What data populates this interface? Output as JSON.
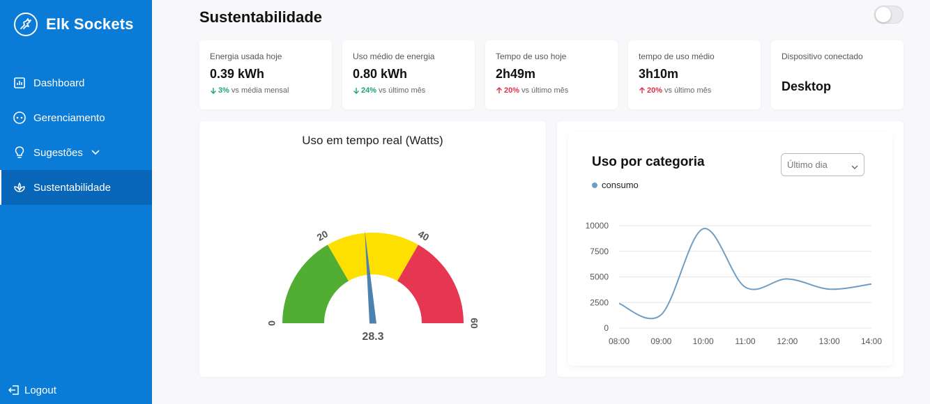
{
  "brand": {
    "name": "Elk Sockets"
  },
  "nav": {
    "items": [
      {
        "label": "Dashboard"
      },
      {
        "label": "Gerenciamento"
      },
      {
        "label": "Sugestões"
      },
      {
        "label": "Sustentabilidade"
      }
    ],
    "logout": "Logout"
  },
  "page": {
    "title": "Sustentabilidade",
    "toggle_on": false
  },
  "stats": [
    {
      "label": "Energia usada hoje",
      "value": "0.39 kWh",
      "direction": "down",
      "pct": "3%",
      "compare": "vs média mensal"
    },
    {
      "label": "Uso médio de energia",
      "value": "0.80 kWh",
      "direction": "down",
      "pct": "24%",
      "compare": "vs último mês"
    },
    {
      "label": "Tempo de uso hoje",
      "value": "2h49m",
      "direction": "up",
      "pct": "20%",
      "compare": "vs último mês"
    },
    {
      "label": "tempo de uso médio",
      "value": "3h10m",
      "direction": "up",
      "pct": "20%",
      "compare": "vs último mês"
    }
  ],
  "device": {
    "label": "Dispositivo conectado",
    "value": "Desktop"
  },
  "gauge": {
    "title": "Uso em tempo real (Watts)",
    "value": 28.3,
    "value_label": "28.3",
    "min": 0,
    "max": 60,
    "ticks": [
      "0",
      "20",
      "40",
      "60"
    ],
    "segments": [
      {
        "from": 0,
        "to": 20,
        "color": "#52ad33"
      },
      {
        "from": 20,
        "to": 40,
        "color": "#fde000"
      },
      {
        "from": 40,
        "to": 60,
        "color": "#e73652"
      }
    ],
    "needle_color": "#4c82b0"
  },
  "usage": {
    "title": "Uso por categoria",
    "period": "Último dia"
  },
  "chart_data": {
    "type": "line",
    "title": "Uso por categoria",
    "x": [
      "08:00",
      "09:00",
      "10:00",
      "11:00",
      "12:00",
      "13:00",
      "14:00"
    ],
    "series": [
      {
        "name": "consumo",
        "values": [
          2400,
          1300,
          9700,
          4000,
          4800,
          3800,
          4300
        ]
      }
    ],
    "yticks": [
      "0",
      "2500",
      "5000",
      "7500",
      "10000"
    ],
    "ylim": [
      0,
      10000
    ],
    "grid": true,
    "legend": "top-left",
    "line_color": "#6f9ec5"
  }
}
